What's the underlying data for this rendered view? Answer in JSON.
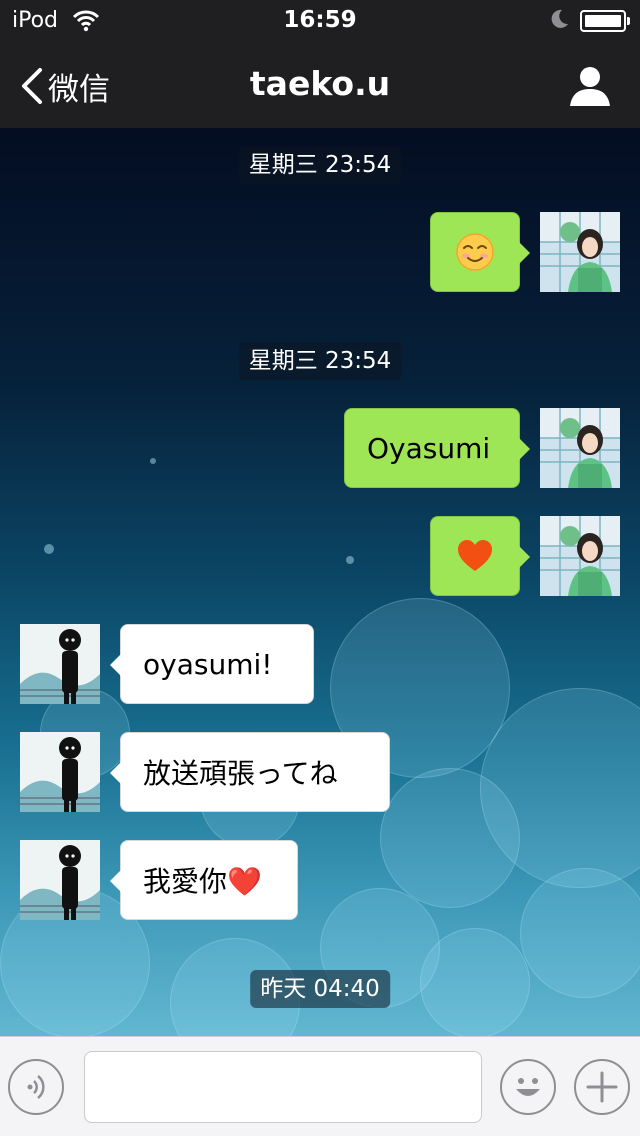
{
  "status_bar": {
    "carrier": "iPod",
    "time": "16:59"
  },
  "nav": {
    "back_label": "微信",
    "title": "taeko.u"
  },
  "messages": {
    "ts1": "星期三 23:54",
    "m1": "☺️",
    "ts2": "星期三 23:54",
    "m2": "Oyasumi",
    "m3": "❤️",
    "m4": "oyasumi!",
    "m5": "放送頑張ってね",
    "m6": "我愛你❤️",
    "ts3": "昨天 04:40"
  },
  "input": {
    "value": "",
    "placeholder": ""
  },
  "colors": {
    "outgoing_bubble": "#9fe656",
    "incoming_bubble": "#ffffff",
    "header": "#1f1f21"
  }
}
